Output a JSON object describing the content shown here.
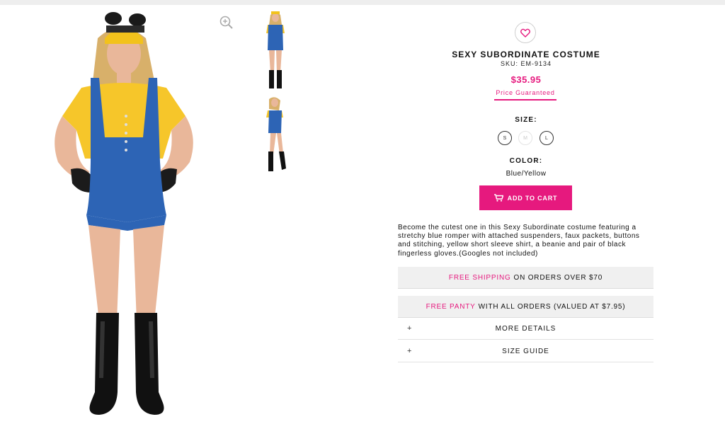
{
  "product": {
    "title": "SEXY SUBORDINATE COSTUME",
    "sku": "SKU: EM-9134",
    "price": "$35.95",
    "price_guarantee": "Price Guaranteed"
  },
  "gallery": {
    "main_image_icon": "costume-photo",
    "zoom_icon": "zoom-in-icon",
    "thumbnails": [
      "costume-front-thumbnail",
      "costume-side-thumbnail"
    ]
  },
  "size": {
    "label": "SIZE:",
    "options": [
      "S",
      "M",
      "L"
    ],
    "unavailable": [
      "M"
    ]
  },
  "color": {
    "label": "COLOR:",
    "value": "Blue/Yellow"
  },
  "cart": {
    "label": "ADD TO CART",
    "icon": "cart-icon"
  },
  "description": "Become the cutest one in this Sexy Subordinate costume featuring a stretchy blue romper with attached suspenders, faux packets, buttons and stitching, yellow short sleeve shirt, a beanie and pair of black fingerless gloves.(Googles not included)",
  "promos": [
    {
      "highlight": "FREE SHIPPING",
      "rest": "ON ORDERS OVER $70"
    },
    {
      "highlight": "FREE PANTY",
      "rest": "WITH ALL ORDERS (VALUED AT $7.95)"
    }
  ],
  "accordions": [
    {
      "symbol": "+",
      "label": "MORE DETAILS"
    },
    {
      "symbol": "+",
      "label": "SIZE GUIDE"
    }
  ],
  "colors": {
    "accent": "#e6197e",
    "promo_bg": "#f0f0f0"
  }
}
